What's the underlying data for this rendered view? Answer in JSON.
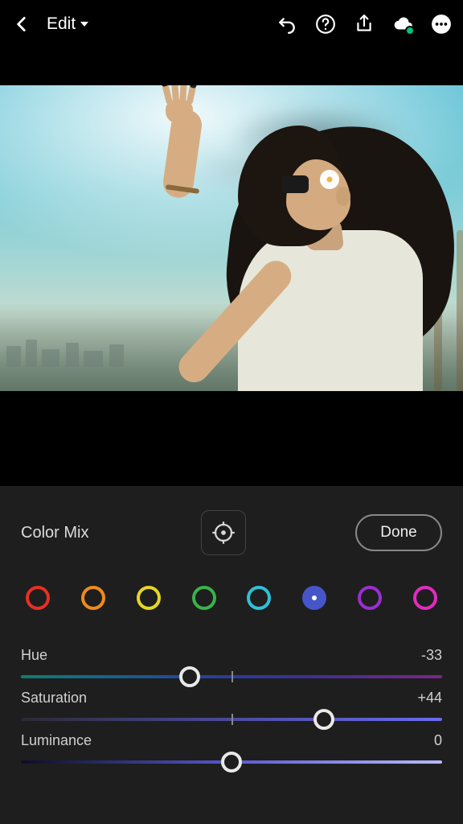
{
  "header": {
    "title": "Edit"
  },
  "panel": {
    "title": "Color Mix",
    "done_label": "Done"
  },
  "swatches": [
    {
      "name": "red",
      "color": "#e53124",
      "selected": false
    },
    {
      "name": "orange",
      "color": "#ef8a1d",
      "selected": false
    },
    {
      "name": "yellow",
      "color": "#e5d625",
      "selected": false
    },
    {
      "name": "green",
      "color": "#39b24a",
      "selected": false
    },
    {
      "name": "aqua",
      "color": "#2fc0d7",
      "selected": false
    },
    {
      "name": "blue",
      "color": "#4656c9",
      "selected": true
    },
    {
      "name": "purple",
      "color": "#9a2fd1",
      "selected": false
    },
    {
      "name": "magenta",
      "color": "#e12bc0",
      "selected": false
    }
  ],
  "sliders": {
    "hue": {
      "label": "Hue",
      "value": "-33",
      "thumb_pct": 40
    },
    "saturation": {
      "label": "Saturation",
      "value": "+44",
      "thumb_pct": 72
    },
    "luminance": {
      "label": "Luminance",
      "value": "0",
      "thumb_pct": 50
    }
  }
}
